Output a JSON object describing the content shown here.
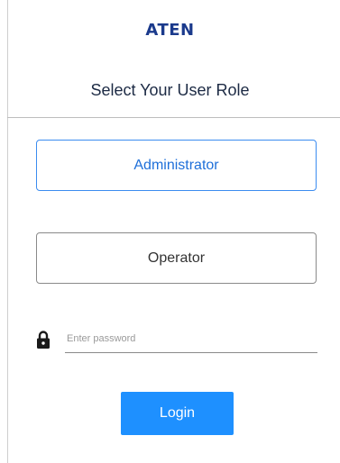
{
  "brand": {
    "logo_text": "ATEN",
    "logo_color": "#1b3a8c"
  },
  "header": {
    "title": "Select Your User Role"
  },
  "roles": [
    {
      "label": "Administrator",
      "selected": true,
      "accent": "#3b8cf0"
    },
    {
      "label": "Operator",
      "selected": false
    }
  ],
  "password": {
    "icon": "lock-icon",
    "placeholder": "Enter password",
    "value": ""
  },
  "login": {
    "label": "Login",
    "color": "#1e90ff"
  }
}
